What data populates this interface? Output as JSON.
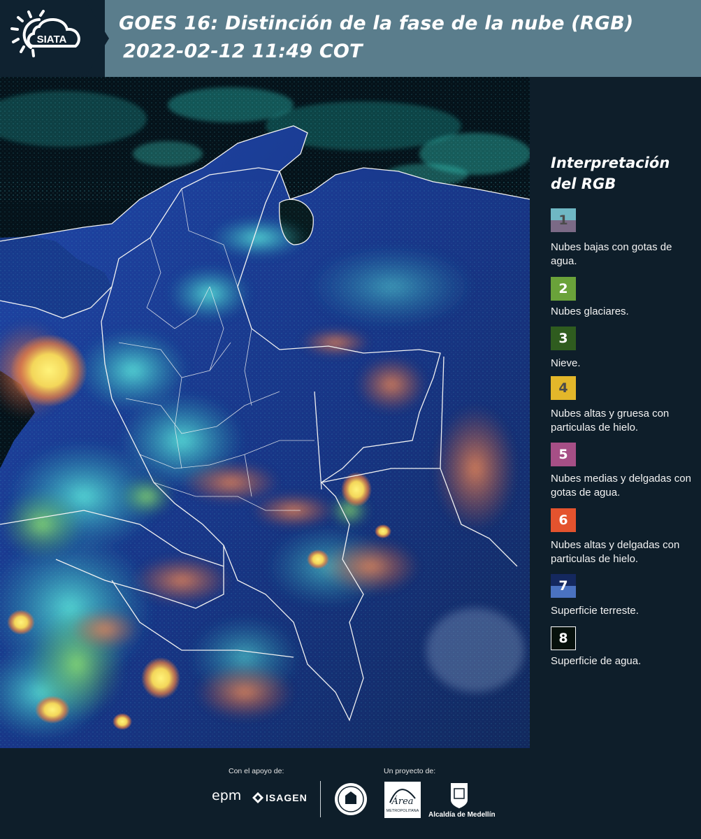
{
  "header": {
    "logo_text": "SIATA",
    "title_line1": "GOES 16: Distinción de la fase de la nube (RGB)",
    "title_line2": "2022-02-12 11:49 COT"
  },
  "legend": {
    "title_line1": "Interpretación",
    "title_line2": "del RGB",
    "items": [
      {
        "num": "1",
        "label": "Nubes bajas con gotas de agua.",
        "color_top": "#6fb7c4",
        "color_bottom": "#7b6a86",
        "text_color": "#4b4b4b"
      },
      {
        "num": "2",
        "label": "Nubes glaciares.",
        "color_top": "#6aa23a",
        "color_bottom": "#6aa23a",
        "text_color": "#ffffff"
      },
      {
        "num": "3",
        "label": "Nieve.",
        "color_top": "#2f5c1f",
        "color_bottom": "#2f5c1f",
        "text_color": "#ffffff"
      },
      {
        "num": "4",
        "label": "Nubes altas y gruesa con particulas de hielo.",
        "color_top": "#e3b72a",
        "color_bottom": "#e3b72a",
        "text_color": "#4b4b4b"
      },
      {
        "num": "5",
        "label": "Nubes medias y delgadas con gotas de agua.",
        "color_top": "#a64f86",
        "color_bottom": "#a64f86",
        "text_color": "#ffffff"
      },
      {
        "num": "6",
        "label": "Nubes altas y delgadas con particulas de hielo.",
        "color_top": "#e4532e",
        "color_bottom": "#e4532e",
        "text_color": "#ffffff"
      },
      {
        "num": "7",
        "label": "Superficie terreste.",
        "color_top": "#14285e",
        "color_bottom": "#4a72c0",
        "text_color": "#ffffff"
      },
      {
        "num": "8",
        "label": "Superficie de agua.",
        "color_top": "#07110c",
        "color_bottom": "#07110c",
        "text_color": "#ffffff"
      }
    ]
  },
  "footer": {
    "support_label": "Con el apoyo de:",
    "project_label": "Un proyecto de:",
    "epm": "epm",
    "isagen": "ISAGEN",
    "area": "Área",
    "area_sub": "METROPOLITANA",
    "alcaldia": "Alcaldía de Medellín"
  },
  "colors": {
    "header_bg": "#5a7d8c",
    "panel_bg": "#0e1e2a",
    "land": "#1b3a8a",
    "ocean": "#04121a"
  }
}
